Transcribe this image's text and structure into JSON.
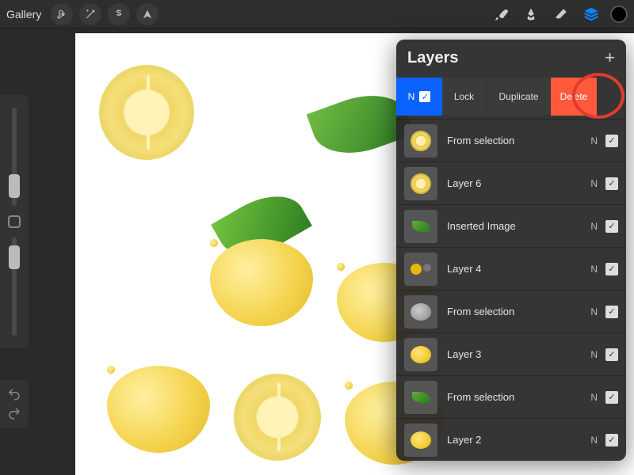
{
  "topbar": {
    "gallery": "Gallery"
  },
  "layers_panel": {
    "title": "Layers",
    "actions": {
      "blend": "N",
      "lock": "Lock",
      "duplicate": "Duplicate",
      "delete": "Delete"
    },
    "items": [
      {
        "name": "From selection",
        "blend": "N",
        "thumb": "half"
      },
      {
        "name": "Layer 6",
        "blend": "N",
        "thumb": "half"
      },
      {
        "name": "Inserted Image",
        "blend": "N",
        "thumb": "leaf"
      },
      {
        "name": "Layer 4",
        "blend": "N",
        "thumb": "two"
      },
      {
        "name": "From selection",
        "blend": "N",
        "thumb": "gray"
      },
      {
        "name": "Layer 3",
        "blend": "N",
        "thumb": "lemon"
      },
      {
        "name": "From selection",
        "blend": "N",
        "thumb": "leaf"
      },
      {
        "name": "Layer 2",
        "blend": "N",
        "thumb": "lemon"
      }
    ]
  },
  "colors": {
    "accent": "#0a84ff",
    "delete": "#ff5a3c",
    "highlight_ring": "#e23b2e"
  }
}
